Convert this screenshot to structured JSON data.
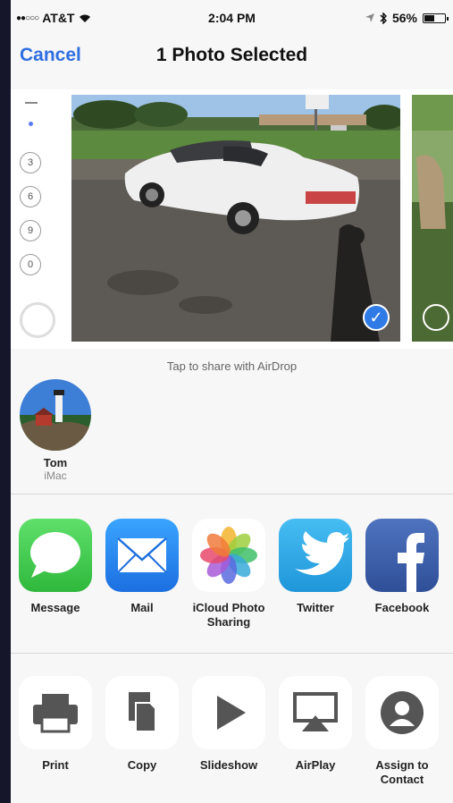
{
  "status": {
    "carrier": "AT&T",
    "time": "2:04 PM",
    "battery": "56%",
    "battery_level": 0.56
  },
  "nav": {
    "cancel": "Cancel",
    "title": "1 Photo Selected"
  },
  "left_thumb_numbers": [
    "3",
    "6",
    "9",
    "0"
  ],
  "airdrop_hint": "Tap to share with AirDrop",
  "contact": {
    "name": "Tom",
    "device": "iMac"
  },
  "apps": [
    {
      "label": "Message",
      "icon": "message-icon"
    },
    {
      "label": "Mail",
      "icon": "mail-icon"
    },
    {
      "label": "iCloud Photo Sharing",
      "icon": "photos-icon"
    },
    {
      "label": "Twitter",
      "icon": "twitter-icon"
    },
    {
      "label": "Facebook",
      "icon": "facebook-icon"
    }
  ],
  "actions": [
    {
      "label": "Print",
      "icon": "print-icon"
    },
    {
      "label": "Copy",
      "icon": "copy-icon"
    },
    {
      "label": "Slideshow",
      "icon": "play-icon"
    },
    {
      "label": "AirPlay",
      "icon": "airplay-icon"
    },
    {
      "label": "Assign to Contact",
      "icon": "contact-icon"
    }
  ],
  "colors": {
    "accent": "#2f6fe0",
    "message": "#3ec94a",
    "mail": "#2b8cf2",
    "twitter": "#2fa8e6",
    "facebook": "#3a5ba0"
  }
}
